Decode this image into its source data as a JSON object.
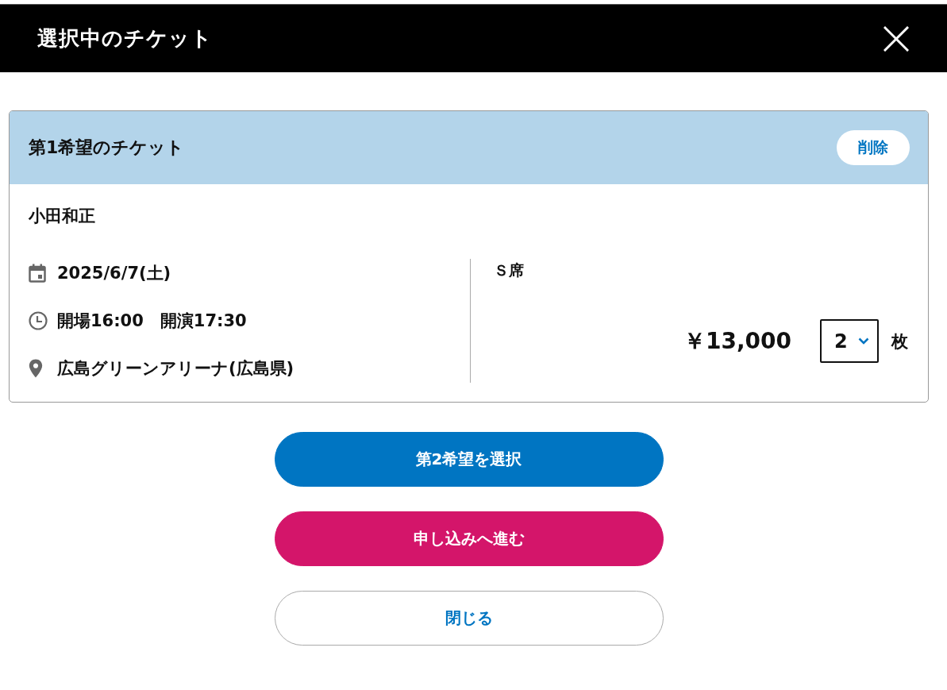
{
  "header": {
    "title": "選択中のチケット"
  },
  "ticket": {
    "title": "第1希望のチケット",
    "delete_button": "削除",
    "artist": "小田和正",
    "details": [
      {
        "kind": "date",
        "text": "2025/6/7(土)"
      },
      {
        "kind": "time",
        "text": "開場16:00　開演17:30"
      },
      {
        "kind": "venue",
        "text": "広島グリーンアリーナ(広島県)"
      }
    ],
    "seat": "Ｓ席",
    "price": "￥13,000",
    "quantity": {
      "value": "2"
    },
    "unit": "枚"
  },
  "buttons": [
    {
      "kind": "primary",
      "label": "第2希望を選択"
    },
    {
      "kind": "accent",
      "label": "申し込みへ進む"
    },
    {
      "kind": "outline",
      "label": "閉じる"
    }
  ]
}
